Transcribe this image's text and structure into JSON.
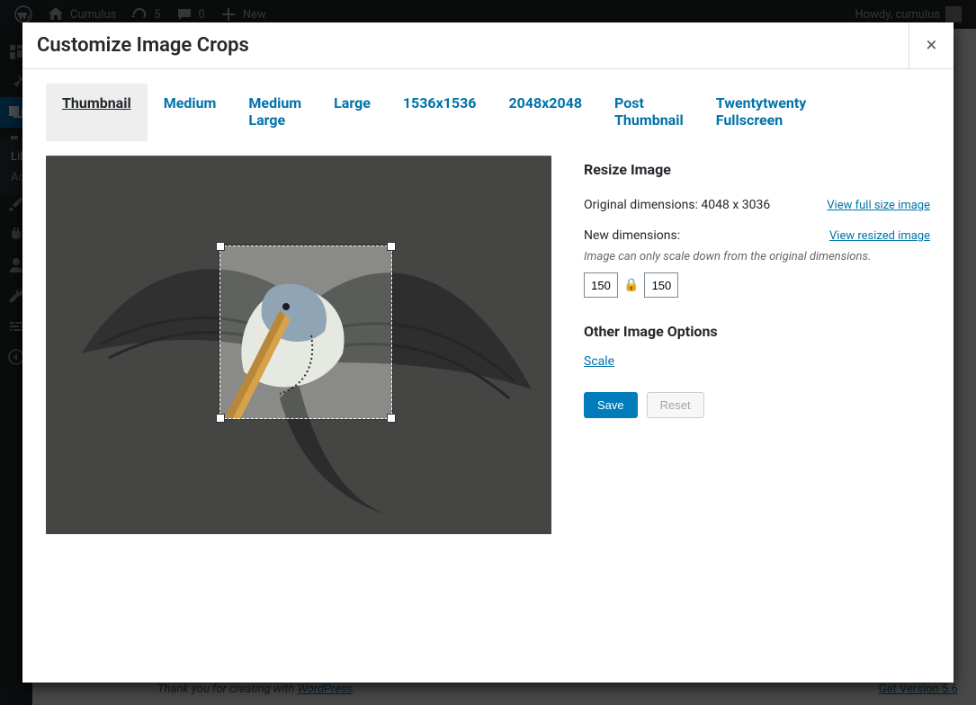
{
  "adminbar": {
    "site_name": "Cumulus",
    "updates_count": "5",
    "comments_count": "0",
    "new_label": "New",
    "howdy": "Howdy, cumulus"
  },
  "submenu": {
    "item1": "Lib",
    "item2": "Ad"
  },
  "footer": {
    "thanks_prefix": "Thank you for creating with ",
    "wp_link": "WordPress",
    "period": ".",
    "version_link": "Get Version 5.6"
  },
  "modal": {
    "title": "Customize Image Crops"
  },
  "tabs": {
    "thumbnail": "Thumbnail",
    "medium": "Medium",
    "medium_large": "Medium\nLarge",
    "large": "Large",
    "s1536": "1536x1536",
    "s2048": "2048x2048",
    "post_thumb": "Post\nThumbnail",
    "twentytwenty": "Twentytwenty\nFullscreen"
  },
  "panel": {
    "resize_heading": "Resize Image",
    "original_label": "Original dimensions: 4048 x 3036",
    "full_link": "View full size image",
    "new_label": "New dimensions:",
    "resized_link": "View resized image",
    "note": "Image can only scale down from the original dimensions.",
    "width": "150",
    "height": "150",
    "other_heading": "Other Image Options",
    "scale_link": "Scale",
    "save": "Save",
    "reset": "Reset"
  }
}
